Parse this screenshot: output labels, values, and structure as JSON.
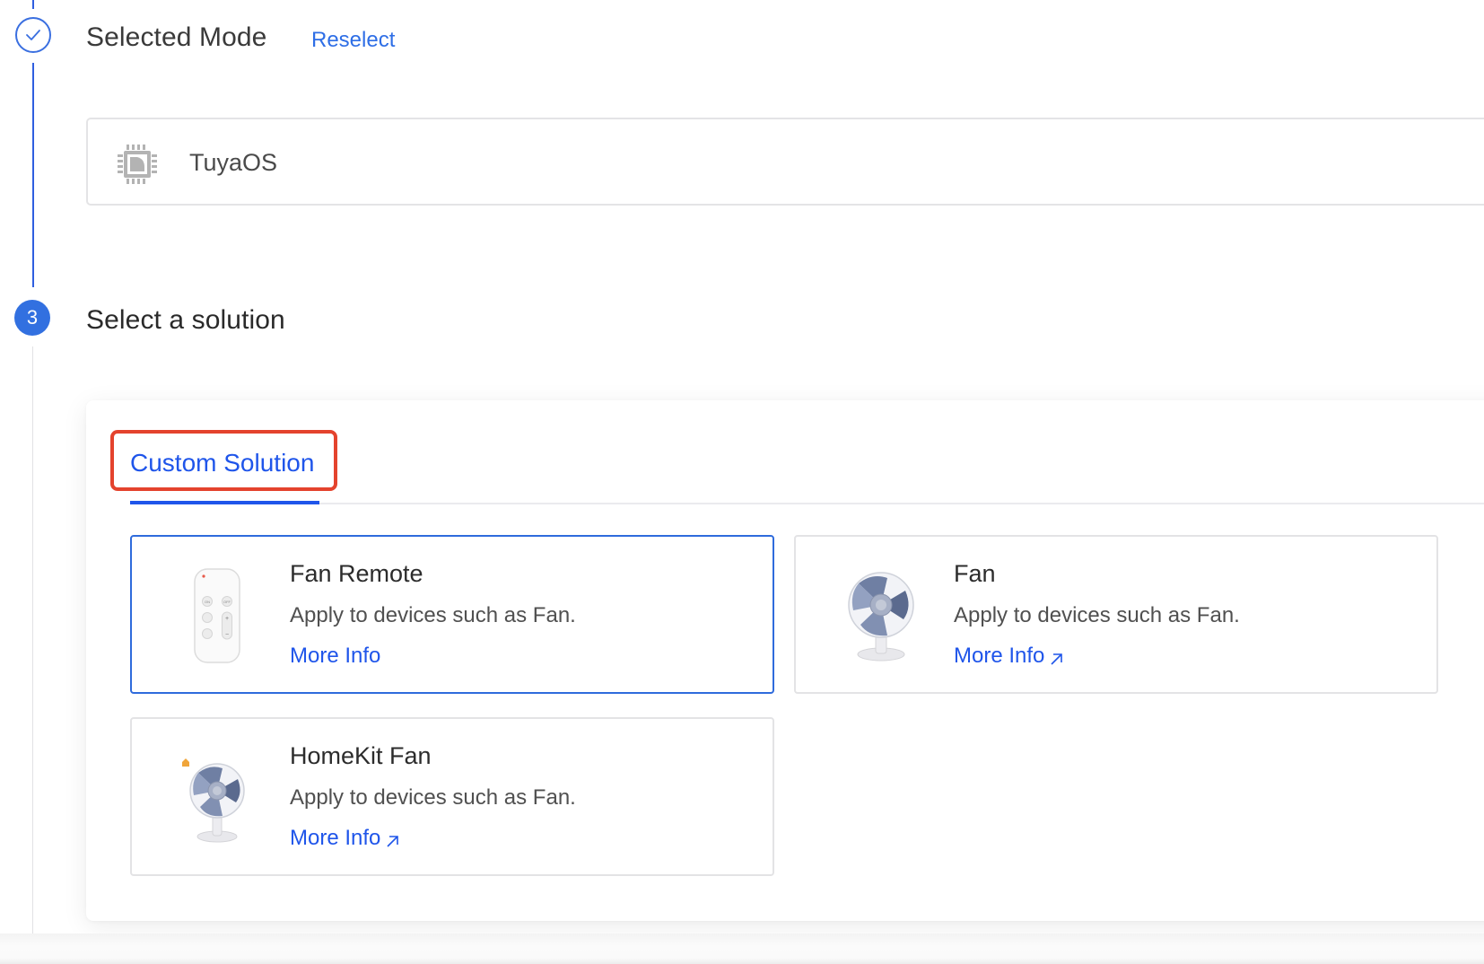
{
  "steps": {
    "selected_mode": {
      "status": "completed",
      "title": "Selected Mode",
      "reselect_label": "Reselect",
      "mode": {
        "icon": "chip-icon",
        "label": "TuyaOS"
      }
    },
    "select_solution": {
      "step_number": "3",
      "title": "Select a solution",
      "tabs": [
        {
          "label": "Custom Solution",
          "active": true,
          "highlighted": true
        }
      ],
      "solutions": [
        {
          "title": "Fan Remote",
          "description": "Apply to devices such as Fan.",
          "link_label": "More Info",
          "external": false,
          "image": "fan-remote-image",
          "selected": true
        },
        {
          "title": "Fan",
          "description": "Apply to devices such as Fan.",
          "link_label": "More Info",
          "external": true,
          "image": "fan-image",
          "selected": false
        },
        {
          "title": "HomeKit Fan",
          "description": "Apply to devices such as Fan.",
          "link_label": "More Info",
          "external": true,
          "image": "homekit-fan-image",
          "selected": false
        }
      ]
    }
  },
  "colors": {
    "accent": "#1f55ea",
    "step_active": "#3270e0",
    "highlight_box": "#e4432d",
    "selected_card_border": "#2f6bdc"
  }
}
